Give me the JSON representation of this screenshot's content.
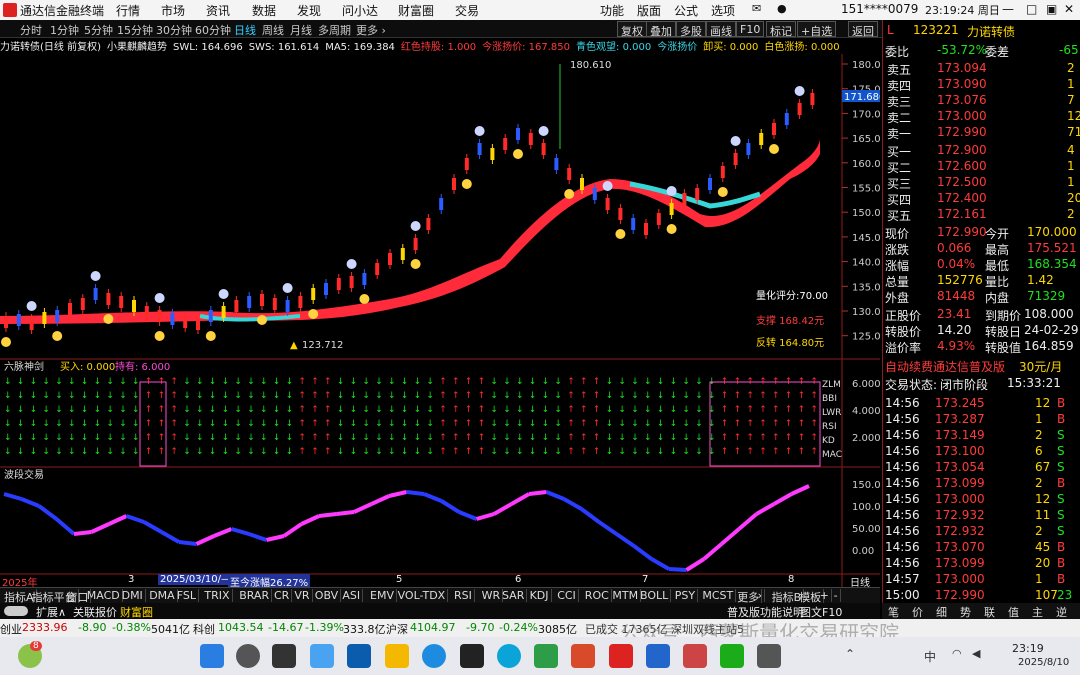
{
  "window": {
    "title": "通达信金融终端",
    "menu": [
      "行情",
      "市场",
      "资讯",
      "数据",
      "发现",
      "问小达",
      "财富圈",
      "交易",
      "功能",
      "版面",
      "公式",
      "选项"
    ],
    "account": "151****0079",
    "datetime": "23:19:24 周日"
  },
  "toolbar": {
    "periods": [
      "分时",
      "1分钟",
      "5分钟",
      "15分钟",
      "30分钟",
      "60分钟",
      "日线",
      "周线",
      "月线",
      "多周期",
      "更多 ›"
    ],
    "active_period": "日线",
    "buttons": [
      "复权",
      "叠加",
      "多股",
      "画线",
      "F10",
      "标记",
      "+自选",
      "返回"
    ]
  },
  "chart_info": {
    "name": "力诺转债(日线 前复权)",
    "indicator": "小果麒麟趋势",
    "swl": "SWL: 164.696",
    "sws": "SWS: 161.614",
    "ma5": "MA5: 169.384",
    "hongjiao": "红色持股: 1.000",
    "jin_tiaozhang": "今涨扬价: 167.850",
    "qingjiao": "青色观望: 0.000",
    "jinbian": "今涨扬价",
    "jimai": "卸买: 0.000",
    "baijiao": "白色涨扬: 0.000"
  },
  "main_chart": {
    "price_ticks": [
      "180.0",
      "175.0",
      "170.0",
      "165.0",
      "160.0",
      "155.0",
      "150.0",
      "145.0",
      "140.0",
      "135.0",
      "130.0",
      "125.0"
    ],
    "high_label": "180.610",
    "low_label": "123.712",
    "current_label": "171.680",
    "score": "量化评分:70.00",
    "support": "支撑 168.42元",
    "resistance": "反转 164.80元"
  },
  "sub1": {
    "title": "六脉神剑",
    "buy": "买入: 0.000",
    "hold": "持有: 6.000",
    "labels": [
      "ZLM",
      "BBI",
      "LWR",
      "RSI",
      "KD",
      "MAC"
    ],
    "ticks": [
      "6.000",
      "4.000",
      "2.000"
    ]
  },
  "sub2": {
    "title": "波段交易",
    "ticks": [
      "150.00",
      "100.00",
      "50.00",
      "0.00"
    ]
  },
  "date_axis": {
    "year": "2025年",
    "marks": [
      "3",
      "4",
      "5",
      "6",
      "7",
      "8"
    ],
    "cursor_date": "2025/03/10/—",
    "cursor_text": "至今涨幅26.27%",
    "period_tag": "日线"
  },
  "bottom_tabs": [
    "指标A",
    "指标平台",
    "窗口",
    "MACD",
    "DMI",
    "DMA",
    "FSL",
    "TRIX",
    "BRAR",
    "CR",
    "VR",
    "OBV",
    "ASI",
    "EMV",
    "VOL-TDX",
    "RSI",
    "WR",
    "SAR",
    "KDJ",
    "CCI",
    "ROC",
    "MTM",
    "BOLL",
    "PSY",
    "MCST",
    "更多",
    "›",
    "指标B",
    "模板",
    "+",
    "-"
  ],
  "bottom_tabs2": [
    "扩展∧",
    "关联报价",
    "财富圈"
  ],
  "bottom_tabs2_right": [
    "普及版功能说明",
    "图文F10"
  ],
  "right": {
    "code": "123221",
    "name": "力诺转债",
    "L": "L",
    "weibi_label": "委比",
    "weibi": "-53.72%",
    "weicha_label": "委差",
    "weicha": "-65",
    "asks": [
      {
        "label": "卖五",
        "price": "173.094",
        "vol": "2"
      },
      {
        "label": "卖四",
        "price": "173.090",
        "vol": "1"
      },
      {
        "label": "卖三",
        "price": "173.076",
        "vol": "7"
      },
      {
        "label": "卖二",
        "price": "173.000",
        "vol": "12"
      },
      {
        "label": "卖一",
        "price": "172.990",
        "vol": "71"
      }
    ],
    "bids": [
      {
        "label": "买一",
        "price": "172.900",
        "vol": "4"
      },
      {
        "label": "买二",
        "price": "172.600",
        "vol": "1"
      },
      {
        "label": "买三",
        "price": "172.500",
        "vol": "1"
      },
      {
        "label": "买四",
        "price": "172.400",
        "vol": "20"
      },
      {
        "label": "买五",
        "price": "172.161",
        "vol": "2"
      }
    ],
    "quote": [
      {
        "l1": "现价",
        "v1": "172.990",
        "c1": "red",
        "l2": "今开",
        "v2": "170.000",
        "c2": "yellow"
      },
      {
        "l1": "涨跌",
        "v1": "0.066",
        "c1": "red",
        "l2": "最高",
        "v2": "175.521",
        "c2": "red"
      },
      {
        "l1": "涨幅",
        "v1": "0.04%",
        "c1": "red",
        "l2": "最低",
        "v2": "168.354",
        "c2": "green"
      },
      {
        "l1": "总量",
        "v1": "152776",
        "c1": "yellow",
        "l2": "量比",
        "v2": "1.42",
        "c2": "yellow"
      },
      {
        "l1": "外盘",
        "v1": "81448",
        "c1": "red",
        "l2": "内盘",
        "v2": "71329",
        "c2": "green"
      }
    ],
    "bond": [
      {
        "l1": "正股价",
        "v1": "23.41",
        "c1": "red",
        "l2": "到期价",
        "v2": "108.000",
        "c2": "white"
      },
      {
        "l1": "转股价",
        "v1": "14.20",
        "c1": "white",
        "l2": "转股日",
        "v2": "24-02-29",
        "c2": "white"
      },
      {
        "l1": "溢价率",
        "v1": "4.93%",
        "c1": "red",
        "l2": "转股值",
        "v2": "164.859",
        "c2": "white"
      }
    ],
    "promo": "自动续费通达信普及版",
    "promo_price": "30元/月",
    "trade_status_label": "交易状态:",
    "trade_status": "闭市阶段",
    "trade_time": "15:33:21",
    "ticks": [
      {
        "t": "14:56",
        "p": "173.245",
        "v": "12",
        "s": "B"
      },
      {
        "t": "14:56",
        "p": "173.287",
        "v": "1",
        "s": "B"
      },
      {
        "t": "14:56",
        "p": "173.149",
        "v": "2",
        "s": "S"
      },
      {
        "t": "14:56",
        "p": "173.100",
        "v": "6",
        "s": "S"
      },
      {
        "t": "14:56",
        "p": "173.054",
        "v": "67",
        "s": "S"
      },
      {
        "t": "14:56",
        "p": "173.099",
        "v": "2",
        "s": "B"
      },
      {
        "t": "14:56",
        "p": "173.000",
        "v": "12",
        "s": "S"
      },
      {
        "t": "14:56",
        "p": "172.932",
        "v": "11",
        "s": "S"
      },
      {
        "t": "14:56",
        "p": "172.932",
        "v": "2",
        "s": "S"
      },
      {
        "t": "14:56",
        "p": "173.070",
        "v": "45",
        "s": "B"
      },
      {
        "t": "14:56",
        "p": "173.099",
        "v": "20",
        "s": "B"
      },
      {
        "t": "14:57",
        "p": "173.000",
        "v": "1",
        "s": "B"
      },
      {
        "t": "15:00",
        "p": "172.990",
        "v": "107",
        "s": "23"
      }
    ],
    "tabs": [
      "笔",
      "价",
      "细",
      "势",
      "联",
      "值",
      "主",
      "逆"
    ]
  },
  "index_bar": [
    {
      "name": "创业",
      "v": "2333.96",
      "c": "-8.90",
      "p": "-0.38%",
      "a": "5041亿"
    },
    {
      "name": "科创",
      "v": "1043.54",
      "c": "-14.67",
      "p": "-1.39%",
      "a": "333.8亿"
    },
    {
      "name": "沪深",
      "v": "4104.97",
      "c": "-9.70",
      "p": "-0.24%",
      "a": "3085亿"
    }
  ],
  "index_extra": "已成交 17365亿 深圳双线主站5",
  "watermark": "公众号 · 西蒙斯量化交易研究院",
  "taskbar": {
    "badge": "8",
    "ime": "中",
    "time": "23:19",
    "date": "2025/8/10"
  }
}
